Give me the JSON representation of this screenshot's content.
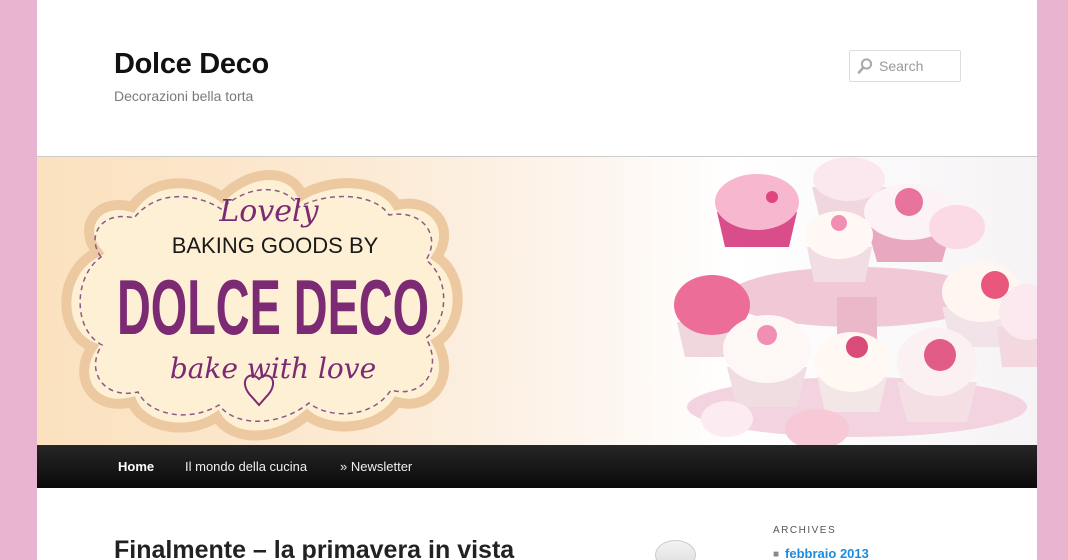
{
  "header": {
    "site_title": "Dolce Deco",
    "site_description": "Decorazioni bella torta",
    "search_placeholder": "Search",
    "search_icon": "magnifier-icon"
  },
  "banner": {
    "line1": "Lovely",
    "line2": "BAKING GOODS BY",
    "line3": "DOLCE DECO",
    "line4": "bake with love",
    "colors": {
      "purple": "#7b2a73",
      "badge": "#fdf1d6",
      "pink": "#e4628c"
    }
  },
  "nav": {
    "items": [
      {
        "label": "Home",
        "active": true
      },
      {
        "label": "Il mondo della cucina",
        "active": false
      },
      {
        "label": "» Newsletter",
        "active": false
      }
    ]
  },
  "main": {
    "post_title": "Finalmente – la primavera in vista"
  },
  "sidebar": {
    "archives_title": "ARCHIVES",
    "archives": [
      "febbraio 2013"
    ]
  }
}
